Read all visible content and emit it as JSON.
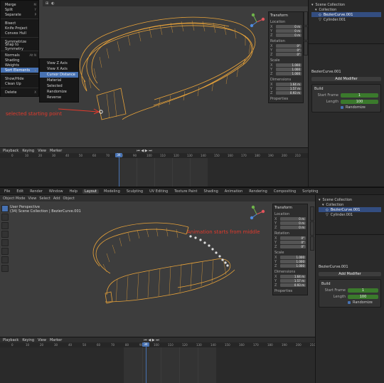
{
  "shot1": {
    "menu_items": [
      {
        "label": "Merge",
        "key": "M"
      },
      {
        "label": "Split",
        "key": "Y"
      },
      {
        "label": "Separate",
        "key": "P"
      },
      {
        "label": "Bisect",
        "key": ""
      },
      {
        "label": "Knife Project",
        "key": ""
      },
      {
        "label": "Convex Hull",
        "key": ""
      },
      {
        "label": "Symmetrize",
        "key": ""
      },
      {
        "label": "Snap to Symmetry",
        "key": ""
      },
      {
        "label": "Normals",
        "key": "Alt N"
      },
      {
        "label": "Shading",
        "key": ""
      },
      {
        "label": "Weights",
        "key": ""
      },
      {
        "label": "Sort Elements",
        "key": ""
      },
      {
        "label": "Show/Hide",
        "key": ""
      },
      {
        "label": "Clean Up",
        "key": ""
      },
      {
        "label": "Delete",
        "key": "X"
      }
    ],
    "submenu_items": [
      "View Z Axis",
      "View X Axis",
      "Cursor Distance",
      "Material",
      "Selected",
      "Randomize",
      "Reverse"
    ],
    "annotation": "selected starting point",
    "outliner": [
      "Scene Collection",
      "Collection",
      "BezierCurve.001",
      "Cylinder.001"
    ],
    "props_title": "BezierCurve.001",
    "add_modifier": "Add Modifier",
    "modifier_name": "Build",
    "start_frame_label": "Start Frame",
    "start_frame_value": "1",
    "length_label": "Length",
    "length_value": "100",
    "randomize_label": "Randomize",
    "timeline_menus": [
      "Playback",
      "Keying",
      "View",
      "Marker"
    ],
    "frame_start": "Start 1",
    "frame_end": "End 250",
    "current_frame": "34",
    "ruler": [
      "0",
      "10",
      "20",
      "30",
      "40",
      "50",
      "60",
      "70",
      "80",
      "90",
      "100",
      "110",
      "120",
      "130",
      "140",
      "150",
      "160",
      "170",
      "180",
      "190",
      "200",
      "210"
    ]
  },
  "shot2": {
    "topbar": [
      "File",
      "Edit",
      "Render",
      "Window",
      "Help",
      "Layout",
      "Modeling",
      "Sculpting",
      "UV Editing",
      "Texture Paint",
      "Shading",
      "Animation",
      "Rendering",
      "Compositing",
      "Scripting"
    ],
    "active_workspace": "Layout",
    "viewport_menus": [
      "Object Mode",
      "View",
      "Select",
      "Add",
      "Object"
    ],
    "view_name": "User Perspective",
    "view_context": "(34) Scene Collection | BezierCurve.001",
    "annotation": "Animation starts from middle",
    "outliner": [
      "Scene Collection",
      "Collection",
      "BezierCurve.001",
      "Cylinder.001"
    ],
    "props_title": "BezierCurve.001",
    "add_modifier": "Add Modifier",
    "modifier_name": "Build",
    "start_frame_label": "Start Frame",
    "start_frame_value": "1",
    "length_label": "Length",
    "length_value": "100",
    "randomize_label": "Randomize",
    "timeline_menus": [
      "Playback",
      "Keying",
      "View",
      "Marker"
    ],
    "current_frame": "34",
    "ruler": [
      "0",
      "10",
      "20",
      "30",
      "40",
      "50",
      "60",
      "70",
      "80",
      "90",
      "100",
      "110",
      "120",
      "130",
      "140",
      "150",
      "160",
      "170",
      "180",
      "190",
      "200",
      "210"
    ]
  },
  "npanel": {
    "header": "Transform",
    "location": "Location",
    "rotation": "Rotation",
    "scale": "Scale",
    "dimensions": "Dimensions",
    "properties": "Properties",
    "loc": [
      "0 m",
      "0 m",
      "0 m"
    ],
    "rot": [
      "0°",
      "0°",
      "0°"
    ],
    "scl": [
      "1.000",
      "1.000",
      "1.000"
    ],
    "dim": [
      "1.64 m",
      "1.57 m",
      "0.93 m"
    ],
    "axes": [
      "X",
      "Y",
      "Z"
    ]
  },
  "colors": {
    "accent": "#4772b3",
    "modifier_green": "#3b7a2c",
    "annotation_red": "#e23a2c",
    "curve_orange": "#e8a33a"
  }
}
